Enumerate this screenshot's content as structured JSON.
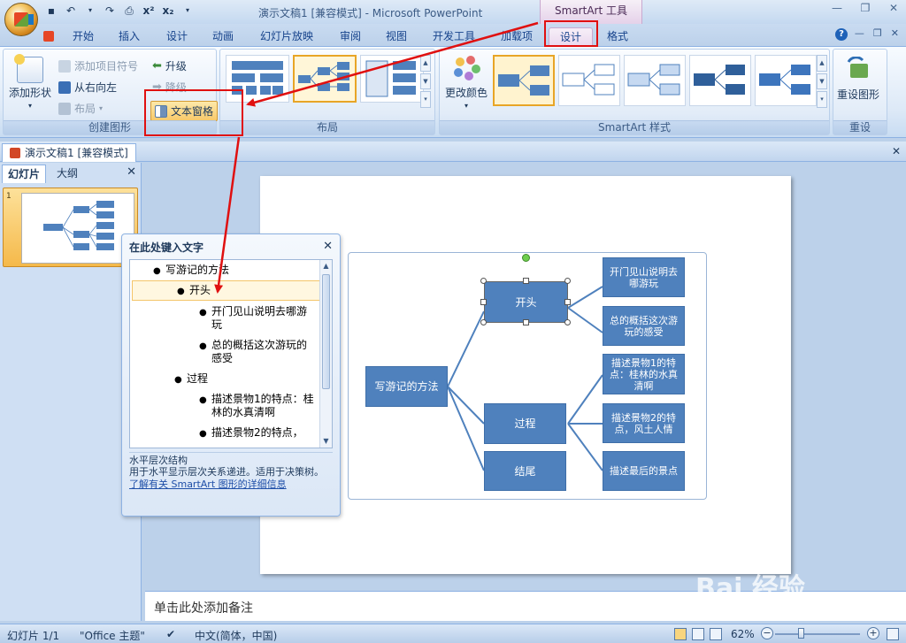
{
  "window": {
    "title": "演示文稿1 [兼容模式] - Microsoft PowerPoint",
    "contextual_header": "SmartArt 工具"
  },
  "qat": {
    "save_icon": "save-icon",
    "undo_icon": "undo-icon",
    "redo_icon": "redo-icon",
    "superscript": "x²",
    "subscript": "x₂"
  },
  "tabs": [
    {
      "label": "开始"
    },
    {
      "label": "插入"
    },
    {
      "label": "设计"
    },
    {
      "label": "动画"
    },
    {
      "label": "幻灯片放映"
    },
    {
      "label": "审阅"
    },
    {
      "label": "视图"
    },
    {
      "label": "开发工具"
    },
    {
      "label": "加载项"
    },
    {
      "label": "设计"
    },
    {
      "label": "格式"
    }
  ],
  "ribbon": {
    "create_graphic": {
      "label": "创建图形",
      "add_shape": "添加形状",
      "add_bullet": "添加项目符号",
      "right_to_left": "从右向左",
      "layout": "布局",
      "promote": "升级",
      "demote": "降级",
      "text_pane": "文本窗格"
    },
    "layouts": {
      "label": "布局"
    },
    "smartart_styles": {
      "label": "SmartArt 样式",
      "change_colors": "更改颜色"
    },
    "reset": {
      "label": "重设",
      "reset_graphic": "重设图形"
    }
  },
  "document_tab": "演示文稿1 [兼容模式]",
  "left_pane": {
    "tab_slides": "幻灯片",
    "tab_outline": "大纲",
    "slide_number": "1"
  },
  "text_pane": {
    "title": "在此处键入文字",
    "items": [
      {
        "level": 1,
        "text": "写游记的方法"
      },
      {
        "level": 2,
        "text": "开头"
      },
      {
        "level": 3,
        "text": "开门见山说明去哪游玩"
      },
      {
        "level": 3,
        "text": "总的概括这次游玩的感受"
      },
      {
        "level": 2,
        "text": "过程"
      },
      {
        "level": 3,
        "text": "描述景物1的特点：桂林的水真清啊"
      },
      {
        "level": 3,
        "text": "描述景物2的特点，"
      }
    ],
    "desc_title": "水平层次结构",
    "desc_body": "用于水平显示层次关系递进。适用于决策树。",
    "desc_link": "了解有关 SmartArt 图形的详细信息"
  },
  "smartart": {
    "root": "写游记的方法",
    "level2": [
      "开头",
      "过程",
      "结尾"
    ],
    "level3": [
      "开门见山说明去哪游玩",
      "总的概括这次游玩的感受",
      "描述景物1的特点：桂林的水真清啊",
      "描述景物2的特点，风土人情",
      "描述最后的景点"
    ],
    "node_color": "#4f81bd"
  },
  "notes": {
    "placeholder": "单击此处添加备注"
  },
  "status": {
    "slide": "幻灯片 1/1",
    "theme": "\"Office 主题\"",
    "language": "中文(简体，中国)",
    "zoom": "62%"
  },
  "watermark": {
    "brand": "Bai 经验",
    "url": "jingyan.baidu.com"
  }
}
